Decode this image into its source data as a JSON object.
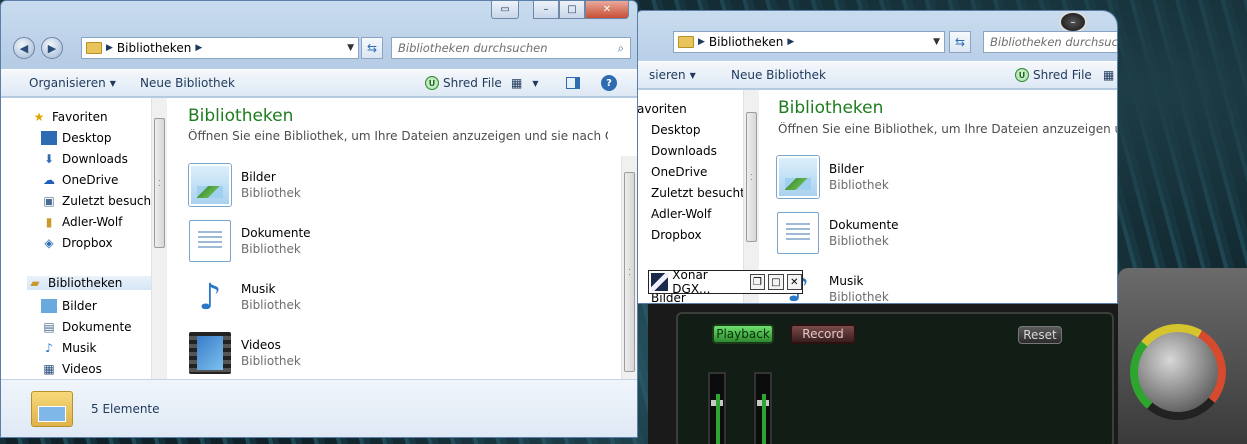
{
  "window_left": {
    "address": {
      "crumb": "Bibliotheken",
      "search_placeholder": "Bibliotheken durchsuchen"
    },
    "toolbar": {
      "organize": "Organisieren",
      "new_library": "Neue Bibliothek",
      "shred": "Shred File"
    },
    "nav": {
      "favorites_header": "Favoriten",
      "favorites": [
        "Desktop",
        "Downloads",
        "OneDrive",
        "Zuletzt besucht",
        "Adler-Wolf",
        "Dropbox"
      ],
      "libraries_header": "Bibliotheken",
      "libraries": [
        "Bilder",
        "Dokumente",
        "Musik",
        "Videos"
      ]
    },
    "content": {
      "title": "Bibliotheken",
      "subtitle": "Öffnen Sie eine Bibliothek, um Ihre Dateien anzuzeigen und sie nach Ordner, ...",
      "items": [
        {
          "name": "Bilder",
          "kind": "Bibliothek"
        },
        {
          "name": "Dokumente",
          "kind": "Bibliothek"
        },
        {
          "name": "Musik",
          "kind": "Bibliothek"
        },
        {
          "name": "Videos",
          "kind": "Bibliothek"
        }
      ]
    },
    "status": "5 Elemente"
  },
  "window_right": {
    "address": {
      "crumb": "Bibliotheken",
      "search_placeholder": "Bibliotheken durchsuchen"
    },
    "toolbar": {
      "organize": "sieren",
      "new_library": "Neue Bibliothek",
      "shred": "Shred File"
    },
    "nav": {
      "favorites_header": "avoriten",
      "items": [
        "Desktop",
        "Downloads",
        "OneDrive",
        "Zuletzt besucht",
        "Adler-Wolf",
        "Dropbox"
      ],
      "libraries_first": "Bilder"
    },
    "content": {
      "title": "Bibliotheken",
      "subtitle": "Öffnen Sie eine Bibliothek, um Ihre Dateien anzuzeigen und sie nach Ordner, ...",
      "items": [
        {
          "name": "Bilder",
          "kind": "Bibliothek"
        },
        {
          "name": "Dokumente",
          "kind": "Bibliothek"
        },
        {
          "name": "Musik",
          "kind": "Bibliothek"
        }
      ]
    }
  },
  "xonar": {
    "title": "Xonar DGX...",
    "playback": "Playback",
    "record": "Record",
    "reset": "Reset"
  },
  "colors": {
    "title_green": "#1e7c1e",
    "accent_blue": "#2d6bb3",
    "playback_green": "#2ea52e"
  }
}
